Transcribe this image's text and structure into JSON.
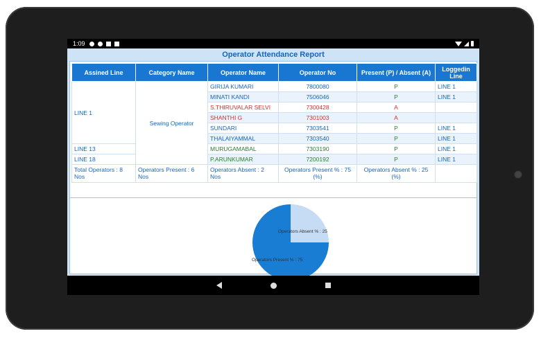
{
  "status": {
    "time": "1:09"
  },
  "report": {
    "title": "Operator Attendance Report",
    "headers": [
      "Assined Line",
      "Category Name",
      "Operator Name",
      "Operator No",
      "Present (P) / Absent (A)",
      "Loggedin Line"
    ],
    "line_groups": [
      "LINE 1",
      "LINE 13",
      "LINE 18"
    ],
    "category": "Sewing Operator",
    "rows": [
      {
        "name": "GIRIJA KUMARI",
        "no": "7800080",
        "status": "P",
        "logged": "LINE 1",
        "color": "#1565c0"
      },
      {
        "name": "MINATI KANDI",
        "no": "7506046",
        "status": "P",
        "logged": "LINE 1",
        "color": "#1565c0"
      },
      {
        "name": "S.THIRUVALAR SELVI",
        "no": "7300428",
        "status": "A",
        "logged": "",
        "color": "#d32f2f"
      },
      {
        "name": "SHANTHI G",
        "no": "7301003",
        "status": "A",
        "logged": "",
        "color": "#d32f2f"
      },
      {
        "name": "SUNDARI",
        "no": "7303541",
        "status": "P",
        "logged": "LINE 1",
        "color": "#1565c0"
      },
      {
        "name": "THALAIYAMMAL",
        "no": "7303540",
        "status": "P",
        "logged": "LINE 1",
        "color": "#1565c0"
      },
      {
        "name": "MURUGAMABAL",
        "no": "7303190",
        "status": "P",
        "logged": "LINE 1",
        "color": "#2e7d32"
      },
      {
        "name": "P.ARUNKUMAR",
        "no": "7200192",
        "status": "P",
        "logged": "LINE 1",
        "color": "#2e7d32"
      }
    ],
    "totals": {
      "total": "Total Operators : 8 Nos",
      "present": "Operators Present : 6 Nos",
      "absent": "Operators Absent : 2 Nos",
      "present_pct": "Operators Present % : 75 (%)",
      "absent_pct": "Operators Absent % : 25 (%)"
    }
  },
  "chart_data": {
    "type": "pie",
    "slices": [
      {
        "label": "Operators Absent % : 25",
        "value": 25,
        "color": "#c6dcf5"
      },
      {
        "label": "Operators Present % : 75",
        "value": 75,
        "color": "#1a7dd4"
      }
    ]
  }
}
